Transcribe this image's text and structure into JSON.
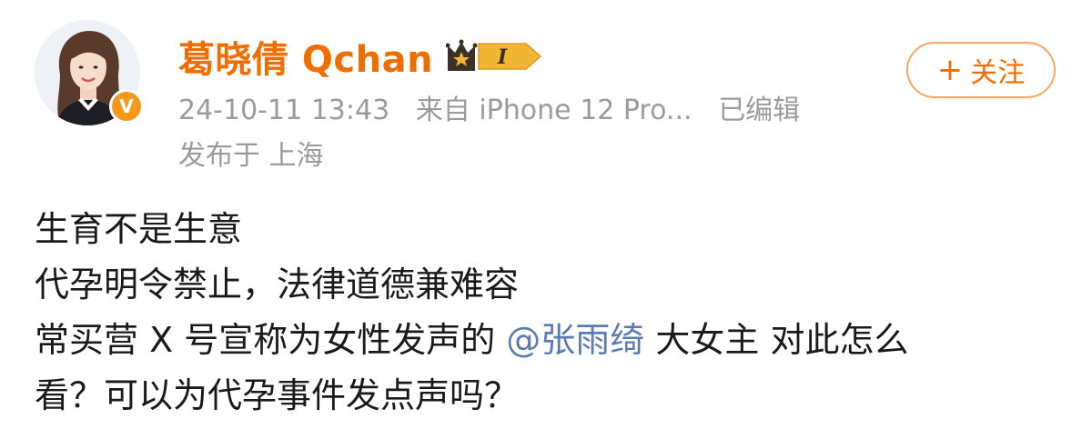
{
  "user": {
    "name": "葛晓倩 Qchan",
    "member_level": "I",
    "verified_mark": "V"
  },
  "meta": {
    "timestamp": "24-10-11 13:43",
    "source": "来自 iPhone 12 Pro...",
    "edited": "已编辑",
    "location": "发布于 上海"
  },
  "follow_button": {
    "icon": "plus-icon",
    "plus": "+",
    "label": "关注"
  },
  "post": {
    "line1": "生育不是生意",
    "line2": "代孕明令禁止，法律道德兼难容",
    "line3_pre": "常买营 X 号宣称为女性发声的 ",
    "mention": "@张雨绮",
    "line3_post": " 大女主 对此怎么",
    "line4": "看？可以为代孕事件发点声吗？"
  },
  "colors": {
    "username": "#f06d00",
    "meta": "#9b9b9b",
    "mention": "#5b7cb2",
    "follow_border": "#f3a760",
    "verified_badge": "#f39a1d",
    "member_badge_gold": "#f2b632",
    "member_badge_dark": "#3a3226"
  }
}
